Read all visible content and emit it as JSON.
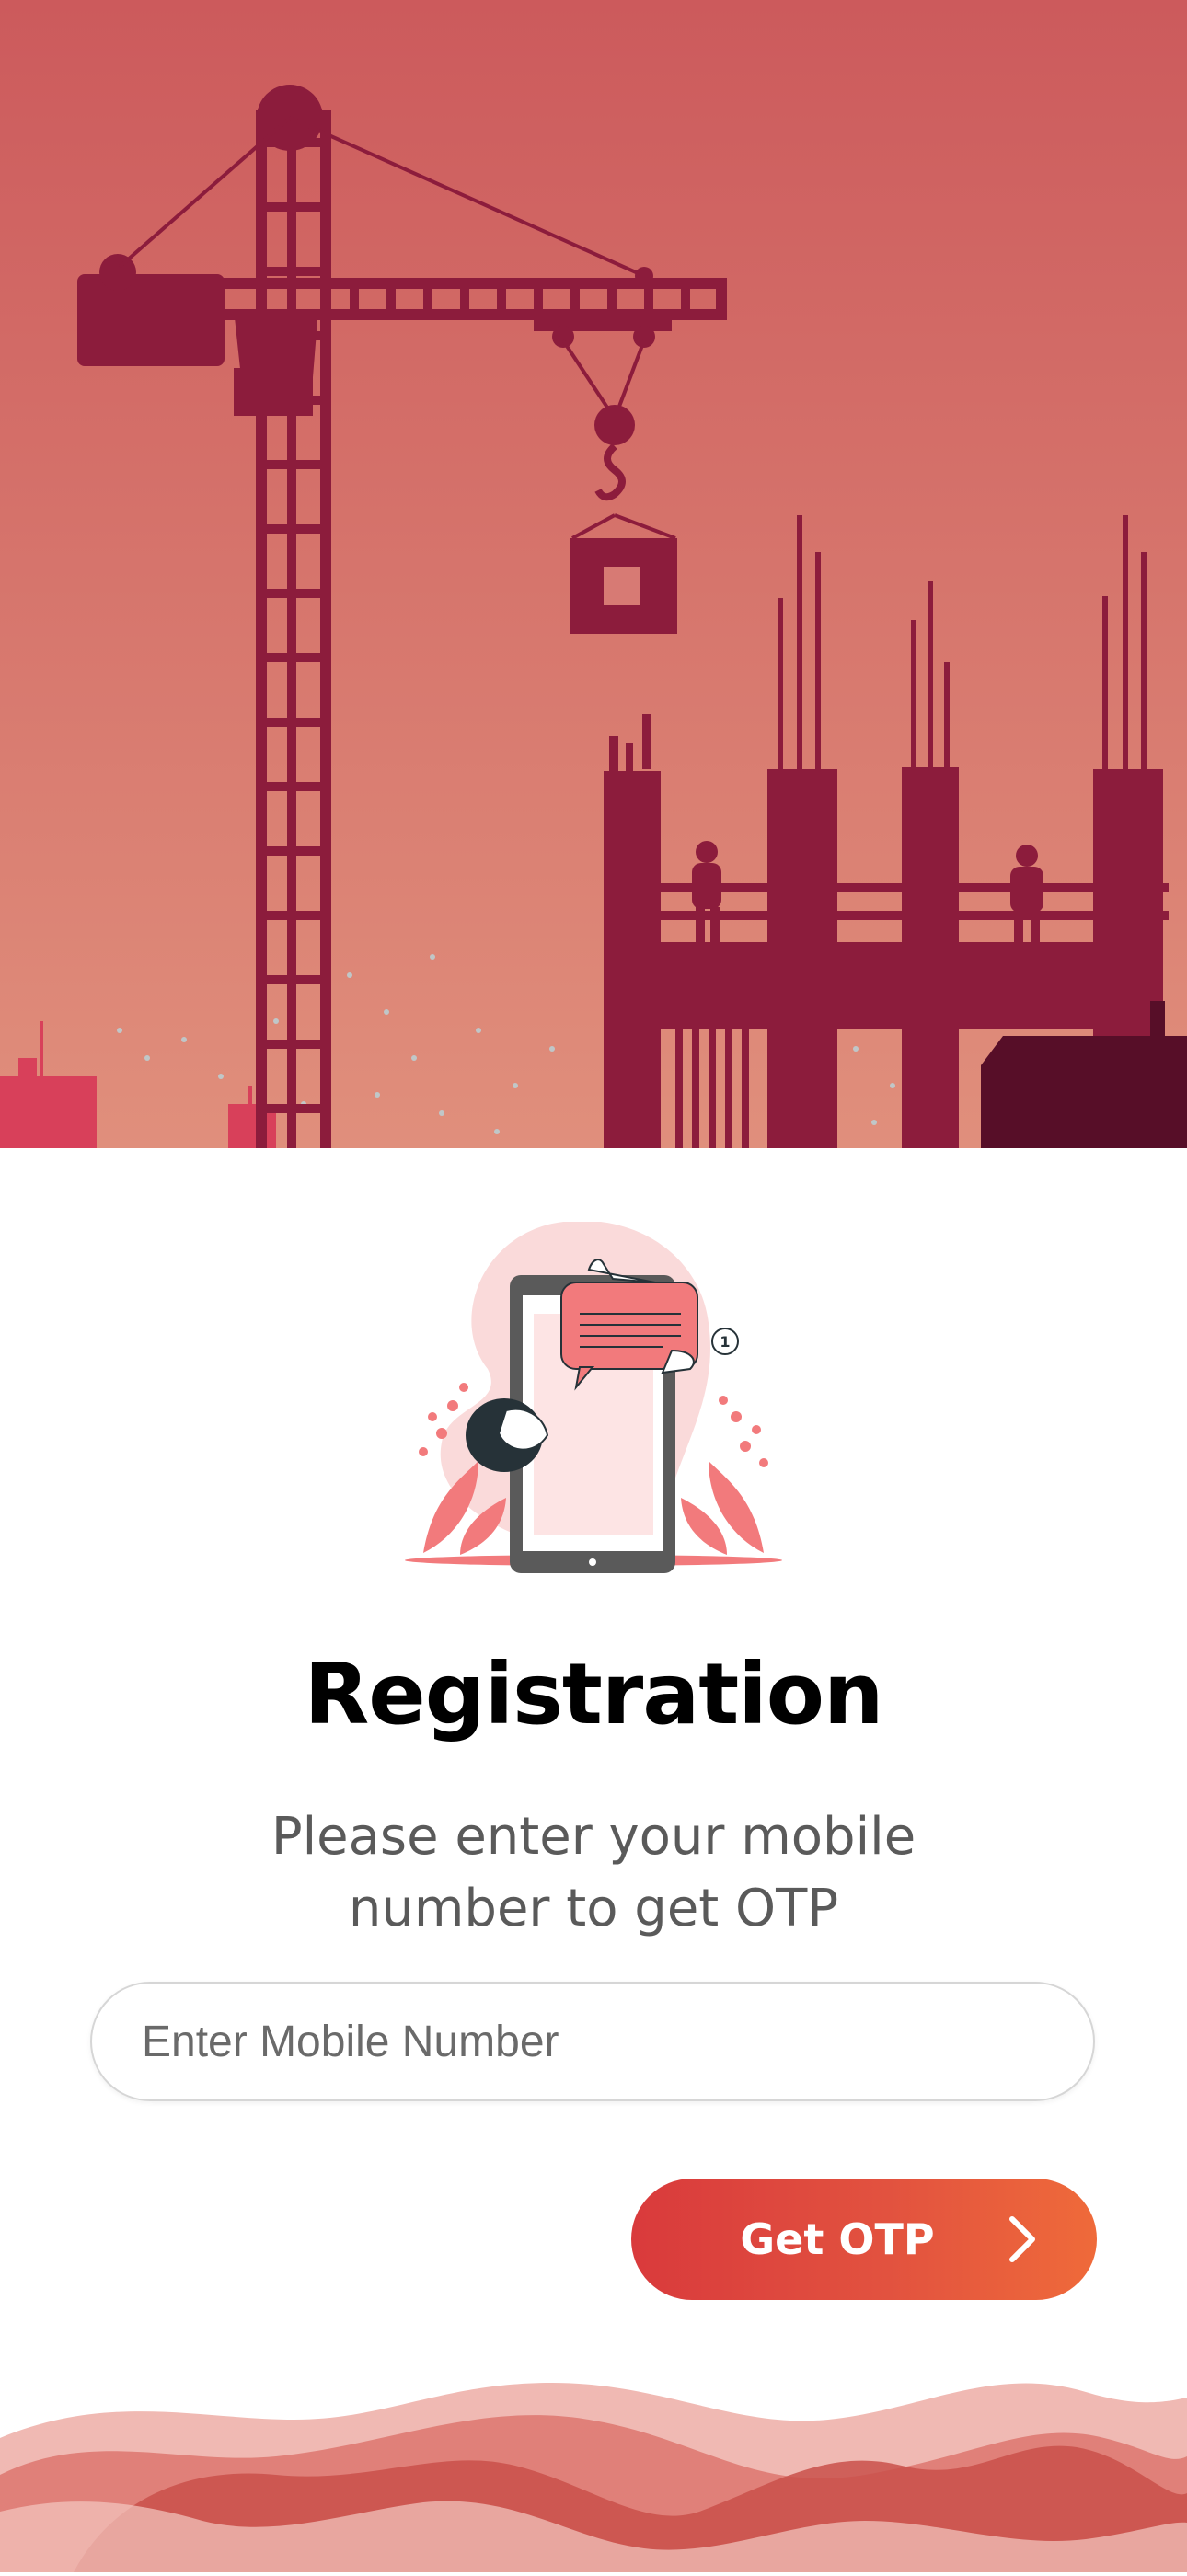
{
  "registration": {
    "title": "Registration",
    "subtitle": "Please enter your mobile number to get OTP",
    "mobile_placeholder": "Enter Mobile Number",
    "mobile_value": "",
    "get_otp_label": "Get OTP",
    "button_icon": "chevron-right-icon"
  },
  "illustration": {
    "notification_count": "1"
  },
  "colors": {
    "hero_top": "#cc5a5c",
    "hero_bottom": "#e08f7c",
    "silhouette": "#8c1c3c",
    "button_start": "#d93a3c",
    "button_end": "#ef6a3a",
    "accent_pink": "#f27a7c"
  }
}
